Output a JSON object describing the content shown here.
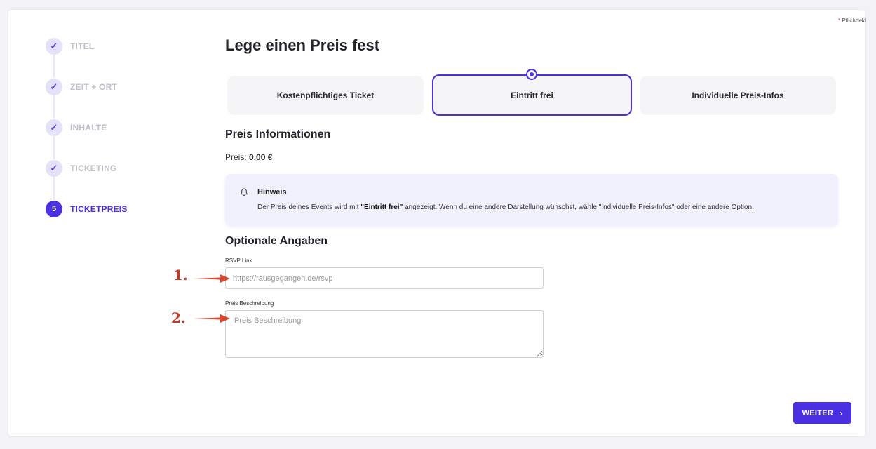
{
  "required_hint": {
    "star": "*",
    "text": "Pflichtfeld"
  },
  "steps": [
    {
      "marker": "✓",
      "label": "TITEL",
      "state": "done"
    },
    {
      "marker": "✓",
      "label": "ZEIT + ORT",
      "state": "done"
    },
    {
      "marker": "✓",
      "label": "INHALTE",
      "state": "done"
    },
    {
      "marker": "✓",
      "label": "TICKETING",
      "state": "done"
    },
    {
      "marker": "5",
      "label": "TICKETPREIS",
      "state": "active"
    }
  ],
  "page_title": "Lege einen Preis fest",
  "price_options": [
    {
      "label": "Kostenpflichtiges Ticket",
      "selected": false
    },
    {
      "label": "Eintritt frei",
      "selected": true
    },
    {
      "label": "Individuelle Preis-Infos",
      "selected": false
    }
  ],
  "price_info": {
    "heading": "Preis Informationen",
    "label": "Preis:",
    "value": "0,00 €"
  },
  "note": {
    "icon": "bell-icon",
    "title": "Hinweis",
    "text_before": "Der Preis deines Events wird mit ",
    "text_bold": "\"Eintritt frei\"",
    "text_after": " angezeigt. Wenn du eine andere Darstellung wünschst, wähle \"Individuelle Preis-Infos\" oder eine andere Option."
  },
  "optional": {
    "heading": "Optionale Angaben",
    "rsvp_label": "RSVP Link",
    "rsvp_placeholder": "https://rausgegangen.de/rsvp",
    "rsvp_value": "",
    "desc_label": "Preis Beschreibung",
    "desc_placeholder": "Preis Beschreibung",
    "desc_value": ""
  },
  "annotations": [
    "1.",
    "2."
  ],
  "next_button": {
    "label": "WEITER",
    "icon": "chevron-right-icon"
  },
  "colors": {
    "accent": "#4a2fe3",
    "annotation": "#c0392b",
    "note_bg": "#f1f0fd"
  }
}
